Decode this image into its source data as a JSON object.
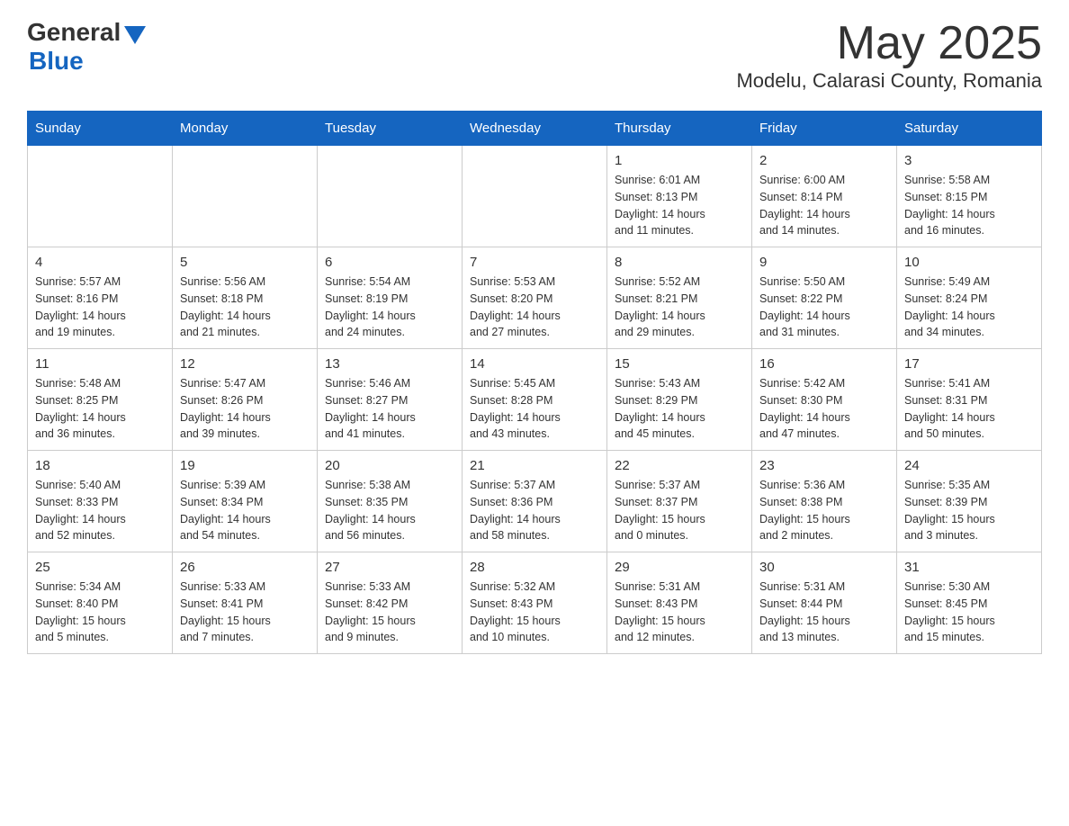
{
  "header": {
    "logo_general": "General",
    "logo_blue": "Blue",
    "title": "May 2025",
    "subtitle": "Modelu, Calarasi County, Romania"
  },
  "days_of_week": [
    "Sunday",
    "Monday",
    "Tuesday",
    "Wednesday",
    "Thursday",
    "Friday",
    "Saturday"
  ],
  "weeks": [
    [
      {
        "day": "",
        "info": ""
      },
      {
        "day": "",
        "info": ""
      },
      {
        "day": "",
        "info": ""
      },
      {
        "day": "",
        "info": ""
      },
      {
        "day": "1",
        "info": "Sunrise: 6:01 AM\nSunset: 8:13 PM\nDaylight: 14 hours\nand 11 minutes."
      },
      {
        "day": "2",
        "info": "Sunrise: 6:00 AM\nSunset: 8:14 PM\nDaylight: 14 hours\nand 14 minutes."
      },
      {
        "day": "3",
        "info": "Sunrise: 5:58 AM\nSunset: 8:15 PM\nDaylight: 14 hours\nand 16 minutes."
      }
    ],
    [
      {
        "day": "4",
        "info": "Sunrise: 5:57 AM\nSunset: 8:16 PM\nDaylight: 14 hours\nand 19 minutes."
      },
      {
        "day": "5",
        "info": "Sunrise: 5:56 AM\nSunset: 8:18 PM\nDaylight: 14 hours\nand 21 minutes."
      },
      {
        "day": "6",
        "info": "Sunrise: 5:54 AM\nSunset: 8:19 PM\nDaylight: 14 hours\nand 24 minutes."
      },
      {
        "day": "7",
        "info": "Sunrise: 5:53 AM\nSunset: 8:20 PM\nDaylight: 14 hours\nand 27 minutes."
      },
      {
        "day": "8",
        "info": "Sunrise: 5:52 AM\nSunset: 8:21 PM\nDaylight: 14 hours\nand 29 minutes."
      },
      {
        "day": "9",
        "info": "Sunrise: 5:50 AM\nSunset: 8:22 PM\nDaylight: 14 hours\nand 31 minutes."
      },
      {
        "day": "10",
        "info": "Sunrise: 5:49 AM\nSunset: 8:24 PM\nDaylight: 14 hours\nand 34 minutes."
      }
    ],
    [
      {
        "day": "11",
        "info": "Sunrise: 5:48 AM\nSunset: 8:25 PM\nDaylight: 14 hours\nand 36 minutes."
      },
      {
        "day": "12",
        "info": "Sunrise: 5:47 AM\nSunset: 8:26 PM\nDaylight: 14 hours\nand 39 minutes."
      },
      {
        "day": "13",
        "info": "Sunrise: 5:46 AM\nSunset: 8:27 PM\nDaylight: 14 hours\nand 41 minutes."
      },
      {
        "day": "14",
        "info": "Sunrise: 5:45 AM\nSunset: 8:28 PM\nDaylight: 14 hours\nand 43 minutes."
      },
      {
        "day": "15",
        "info": "Sunrise: 5:43 AM\nSunset: 8:29 PM\nDaylight: 14 hours\nand 45 minutes."
      },
      {
        "day": "16",
        "info": "Sunrise: 5:42 AM\nSunset: 8:30 PM\nDaylight: 14 hours\nand 47 minutes."
      },
      {
        "day": "17",
        "info": "Sunrise: 5:41 AM\nSunset: 8:31 PM\nDaylight: 14 hours\nand 50 minutes."
      }
    ],
    [
      {
        "day": "18",
        "info": "Sunrise: 5:40 AM\nSunset: 8:33 PM\nDaylight: 14 hours\nand 52 minutes."
      },
      {
        "day": "19",
        "info": "Sunrise: 5:39 AM\nSunset: 8:34 PM\nDaylight: 14 hours\nand 54 minutes."
      },
      {
        "day": "20",
        "info": "Sunrise: 5:38 AM\nSunset: 8:35 PM\nDaylight: 14 hours\nand 56 minutes."
      },
      {
        "day": "21",
        "info": "Sunrise: 5:37 AM\nSunset: 8:36 PM\nDaylight: 14 hours\nand 58 minutes."
      },
      {
        "day": "22",
        "info": "Sunrise: 5:37 AM\nSunset: 8:37 PM\nDaylight: 15 hours\nand 0 minutes."
      },
      {
        "day": "23",
        "info": "Sunrise: 5:36 AM\nSunset: 8:38 PM\nDaylight: 15 hours\nand 2 minutes."
      },
      {
        "day": "24",
        "info": "Sunrise: 5:35 AM\nSunset: 8:39 PM\nDaylight: 15 hours\nand 3 minutes."
      }
    ],
    [
      {
        "day": "25",
        "info": "Sunrise: 5:34 AM\nSunset: 8:40 PM\nDaylight: 15 hours\nand 5 minutes."
      },
      {
        "day": "26",
        "info": "Sunrise: 5:33 AM\nSunset: 8:41 PM\nDaylight: 15 hours\nand 7 minutes."
      },
      {
        "day": "27",
        "info": "Sunrise: 5:33 AM\nSunset: 8:42 PM\nDaylight: 15 hours\nand 9 minutes."
      },
      {
        "day": "28",
        "info": "Sunrise: 5:32 AM\nSunset: 8:43 PM\nDaylight: 15 hours\nand 10 minutes."
      },
      {
        "day": "29",
        "info": "Sunrise: 5:31 AM\nSunset: 8:43 PM\nDaylight: 15 hours\nand 12 minutes."
      },
      {
        "day": "30",
        "info": "Sunrise: 5:31 AM\nSunset: 8:44 PM\nDaylight: 15 hours\nand 13 minutes."
      },
      {
        "day": "31",
        "info": "Sunrise: 5:30 AM\nSunset: 8:45 PM\nDaylight: 15 hours\nand 15 minutes."
      }
    ]
  ]
}
